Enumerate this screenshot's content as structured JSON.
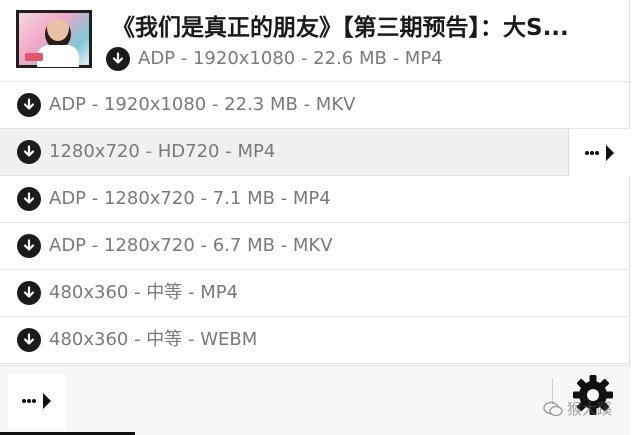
{
  "header": {
    "title": "《我们是真正的朋友》【第三期预告】：大S...",
    "thumbnail_icon": "video-thumbnail",
    "primary_format": "ADP - 1920x1080 - 22.6 MB - MP4"
  },
  "formats": [
    {
      "label": "ADP - 1920x1080 - 22.3 MB - MKV"
    },
    {
      "label": "1280x720 - HD720 - MP4"
    },
    {
      "label": "ADP - 1280x720 - 7.1 MB - MP4"
    },
    {
      "label": "ADP - 1280x720 - 6.7 MB - MKV"
    },
    {
      "label": "480x360 - 中等 - MP4"
    },
    {
      "label": "480x360 - 中等 - WEBM"
    }
  ],
  "footer": {
    "more_icon": "more-arrow-icon",
    "settings_icon": "gear-icon",
    "watermark": "猴大蹊"
  },
  "colors": {
    "text_primary": "#1a1a1a",
    "text_secondary": "#7a7a7a",
    "row_hover": "#f0f0f0",
    "icon": "#1b1b1b"
  }
}
